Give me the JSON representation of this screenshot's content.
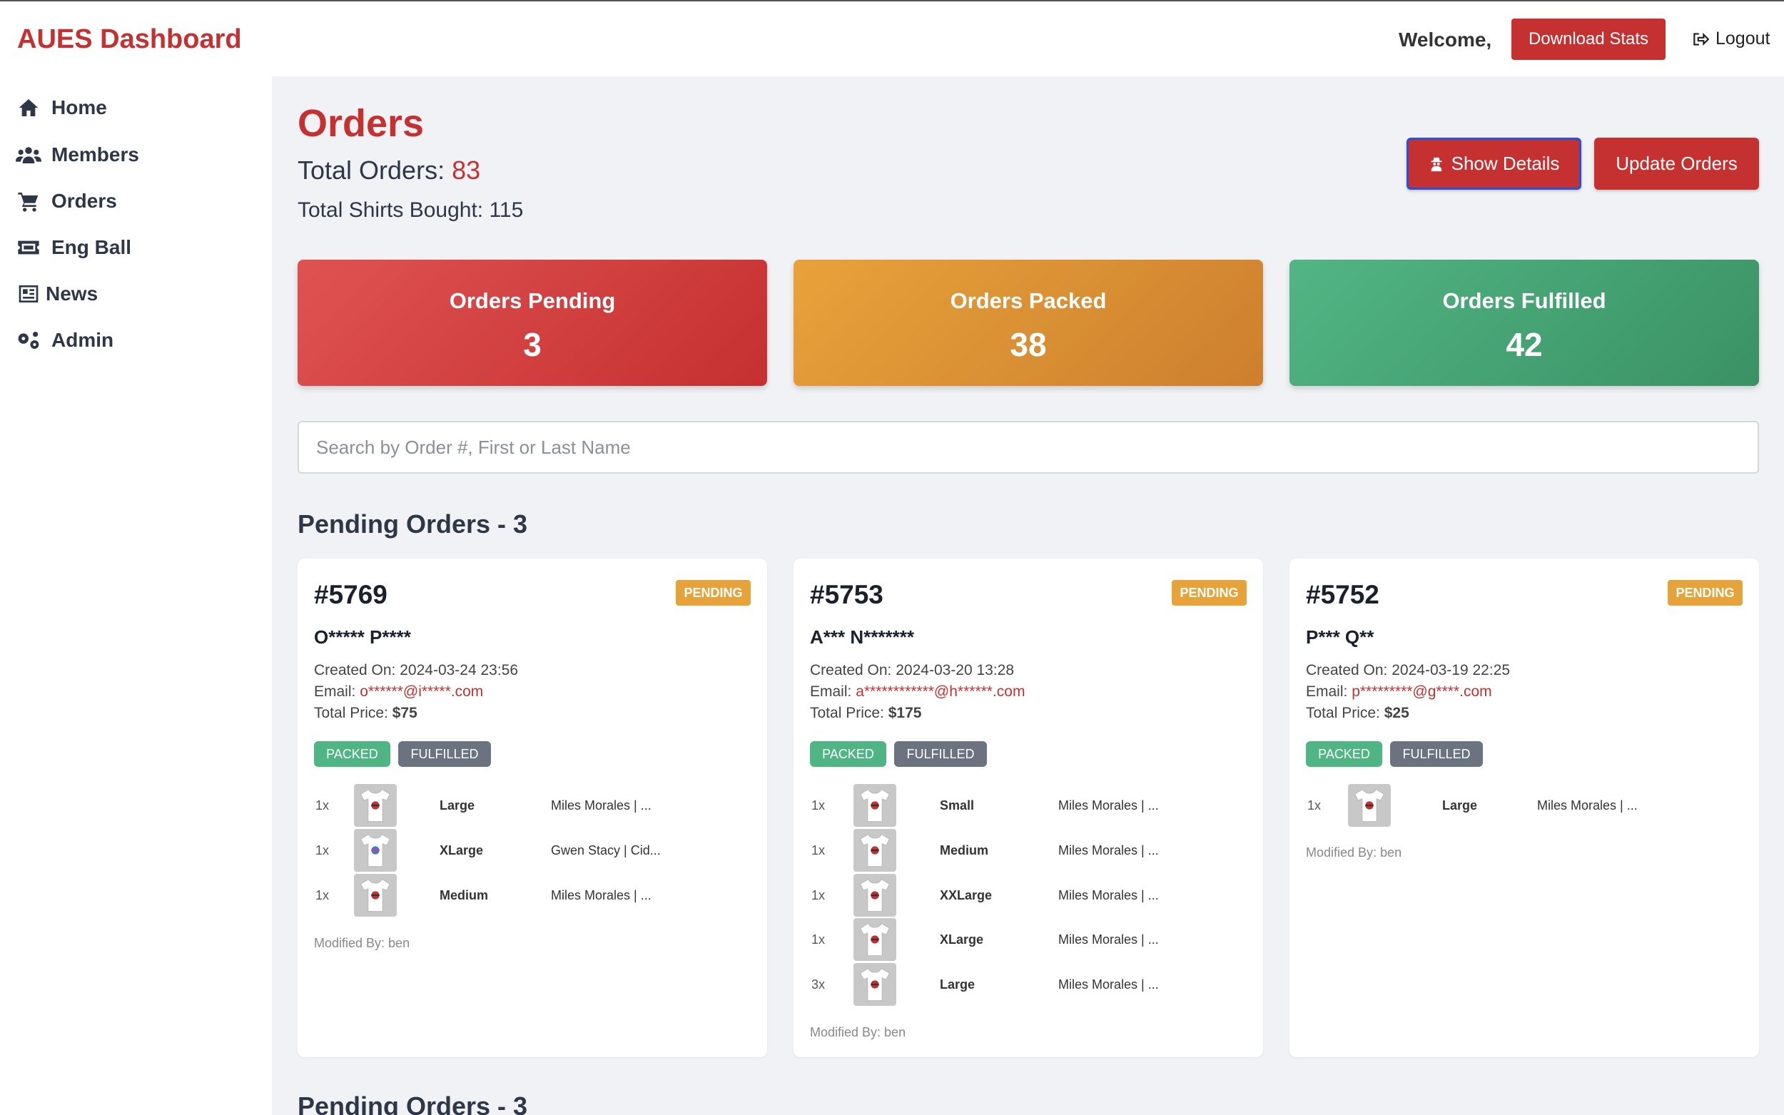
{
  "header": {
    "brand": "AUES Dashboard",
    "welcome": "Welcome,",
    "download_label": "Download Stats",
    "logout_label": "Logout"
  },
  "sidebar": {
    "items": [
      {
        "label": "Home",
        "icon": "home-icon"
      },
      {
        "label": "Members",
        "icon": "users-icon"
      },
      {
        "label": "Orders",
        "icon": "cart-icon"
      },
      {
        "label": "Eng Ball",
        "icon": "ticket-icon"
      },
      {
        "label": "News",
        "icon": "newspaper-icon"
      },
      {
        "label": "Admin",
        "icon": "gears-icon"
      }
    ]
  },
  "page": {
    "title": "Orders",
    "total_orders_label": "Total Orders: ",
    "total_orders_value": "83",
    "total_shirts": "Total Shirts Bought: 115",
    "show_details_label": "Show Details",
    "update_orders_label": "Update Orders"
  },
  "stats": {
    "pending": {
      "label": "Orders Pending",
      "value": "3"
    },
    "packed": {
      "label": "Orders Packed",
      "value": "38"
    },
    "fulfilled": {
      "label": "Orders Fulfilled",
      "value": "42"
    }
  },
  "search": {
    "placeholder": "Search by Order #, First or Last Name",
    "value": ""
  },
  "sections": [
    {
      "title": "Pending Orders - 3"
    },
    {
      "title": "Pending Orders - 3"
    }
  ],
  "orders": [
    {
      "number": "#5769",
      "status": "PENDING",
      "name": "O***** P****",
      "created_label": "Created On: ",
      "created": "2024-03-24 23:56",
      "email_label": "Email: ",
      "email": "o******@i*****.com",
      "price_label": "Total Price: ",
      "price": "$75",
      "packed_label": "PACKED",
      "fulfilled_label": "FULFILLED",
      "items": [
        {
          "qty": "1x",
          "size": "Large",
          "product": "Miles Morales | ..."
        },
        {
          "qty": "1x",
          "size": "XLarge",
          "product": "Gwen Stacy | Cid..."
        },
        {
          "qty": "1x",
          "size": "Medium",
          "product": "Miles Morales | ..."
        }
      ],
      "modified": "Modified By: ben"
    },
    {
      "number": "#5753",
      "status": "PENDING",
      "name": "A*** N*******",
      "created_label": "Created On: ",
      "created": "2024-03-20 13:28",
      "email_label": "Email: ",
      "email": "a************@h******.com",
      "price_label": "Total Price: ",
      "price": "$175",
      "packed_label": "PACKED",
      "fulfilled_label": "FULFILLED",
      "items": [
        {
          "qty": "1x",
          "size": "Small",
          "product": "Miles Morales | ..."
        },
        {
          "qty": "1x",
          "size": "Medium",
          "product": "Miles Morales | ..."
        },
        {
          "qty": "1x",
          "size": "XXLarge",
          "product": "Miles Morales | ..."
        },
        {
          "qty": "1x",
          "size": "XLarge",
          "product": "Miles Morales | ..."
        },
        {
          "qty": "3x",
          "size": "Large",
          "product": "Miles Morales | ..."
        }
      ],
      "modified": "Modified By: ben"
    },
    {
      "number": "#5752",
      "status": "PENDING",
      "name": "P*** Q**",
      "created_label": "Created On: ",
      "created": "2024-03-19 22:25",
      "email_label": "Email: ",
      "email": "p*********@g****.com",
      "price_label": "Total Price: ",
      "price": "$25",
      "packed_label": "PACKED",
      "fulfilled_label": "FULFILLED",
      "items": [
        {
          "qty": "1x",
          "size": "Large",
          "product": "Miles Morales | ..."
        }
      ],
      "modified": "Modified By: ben"
    }
  ],
  "colors": {
    "brand": "#c53030",
    "pending_badge": "#e8a23a",
    "packed": "#4fb584",
    "fulfilled": "#6b7280"
  }
}
